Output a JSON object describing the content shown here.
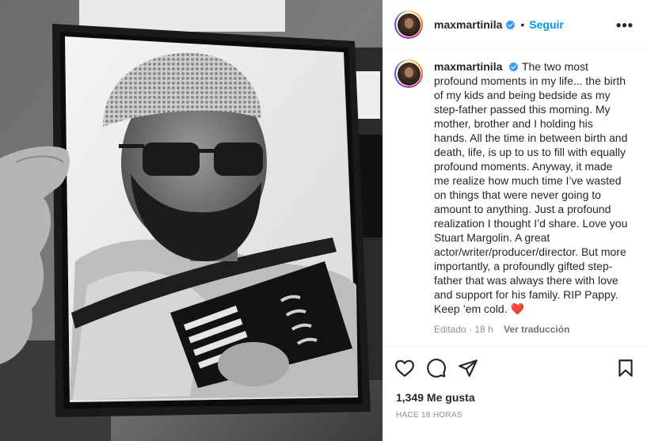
{
  "post": {
    "username": "maxmartinila",
    "follow_label": "Seguir",
    "separator": "•",
    "more_label": "•••",
    "caption": {
      "username": "maxmartinila",
      "text": "The two most profound moments in my life... the birth of my kids and being bedside as my step-father passed this morning. My mother, brother and I holding his hands. All the time in between birth and death, life, is up to us to fill with equally profound moments. Anyway, it made me realize how much time I’ve wasted on things that were never going to amount to anything. Just a profound realization I thought I’d share. Love you Stuart Margolin. A great actor/writer/producer/director. But more importantly, a profoundly gifted step-father that was always there with love and support for his family. RIP Pappy. Keep ’em cold.",
      "emoji": "❤️",
      "edited_label": "Editado · 18 h",
      "translate_label": "Ver traducción"
    },
    "likes_label": "1,349 Me gusta",
    "timestamp_label": "HACE 18 HORAS"
  },
  "icons": {
    "verified": "verified-badge-icon",
    "like": "heart-icon",
    "comment": "comment-icon",
    "share": "paper-plane-icon",
    "save": "bookmark-icon",
    "more": "more-options-icon"
  },
  "colors": {
    "accent": "#0095f6",
    "text": "#262626",
    "muted": "#8e8e8e",
    "verified": "#3897f0",
    "heart": "#e8112d"
  }
}
